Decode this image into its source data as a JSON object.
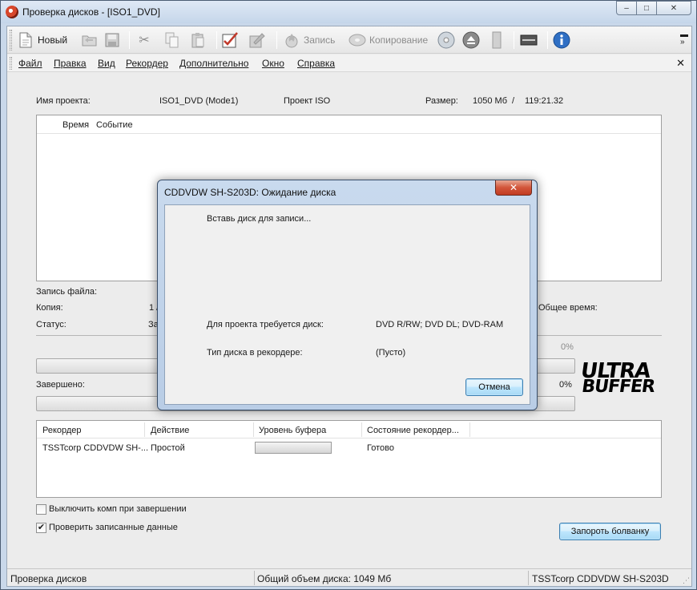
{
  "window": {
    "title": "Проверка дисков - [ISO1_DVD]",
    "min": "–",
    "max": "□",
    "close": "✕"
  },
  "toolbar": {
    "new_label": "Новый",
    "burn_label": "Запись",
    "copy_label": "Копирование"
  },
  "menu": [
    "Файл",
    "Правка",
    "Вид",
    "Рекордер",
    "Дополнительно",
    "Окно",
    "Справка"
  ],
  "menu_close": "✕",
  "project": {
    "name_label": "Имя проекта:",
    "name_value": "ISO1_DVD (Mode1)",
    "type_value": "Проект ISO",
    "size_label": "Размер:",
    "size_value": "1050 Мб",
    "size_sep": "/",
    "time_value": "119:21.32"
  },
  "events": {
    "col_time": "Время",
    "col_event": "Событие"
  },
  "progress_info": {
    "file_label": "Запись файла:",
    "copy_label": "Копия:",
    "copy_value_partial": "1 /",
    "status_label": "Статус:",
    "status_value_partial": "За",
    "total_time_label": "Общее время:",
    "progress1_pct": "0%",
    "done_label": "Завершено:",
    "progress2_pct": "0%",
    "progress1_fraction": 0,
    "progress2_fraction": 0
  },
  "logo": {
    "line1": "ULTRA",
    "line2": "BUFFER"
  },
  "recorders": {
    "columns": [
      "Рекордер",
      "Действие",
      "Уровень буфера",
      "Состояние рекордер..."
    ],
    "rows": [
      {
        "recorder": "TSSTcorp CDDVDW SH-...",
        "action": "Простой",
        "state": "Готово"
      }
    ]
  },
  "options": {
    "shutdown_label": "Выключить комп при завершении",
    "shutdown_checked": false,
    "verify_label": "Проверить записанные данные",
    "verify_checked": true
  },
  "burn_button": "Запороть болванку",
  "statusbar": {
    "left": "Проверка дисков",
    "middle": "Общий объем диска: 1049 Мб",
    "right": "TSSTcorp CDDVDW SH-S203D"
  },
  "dialog": {
    "title": "CDDVDW SH-S203D: Ожидание диска",
    "close": "✕",
    "message": "Вставь диск для записи...",
    "required_label": "Для проекта требуется диск:",
    "required_value": "DVD R/RW; DVD DL; DVD-RAM",
    "disk_type_label": "Тип диска в рекордере:",
    "disk_type_value": "(Пусто)",
    "cancel_button": "Отмена"
  }
}
